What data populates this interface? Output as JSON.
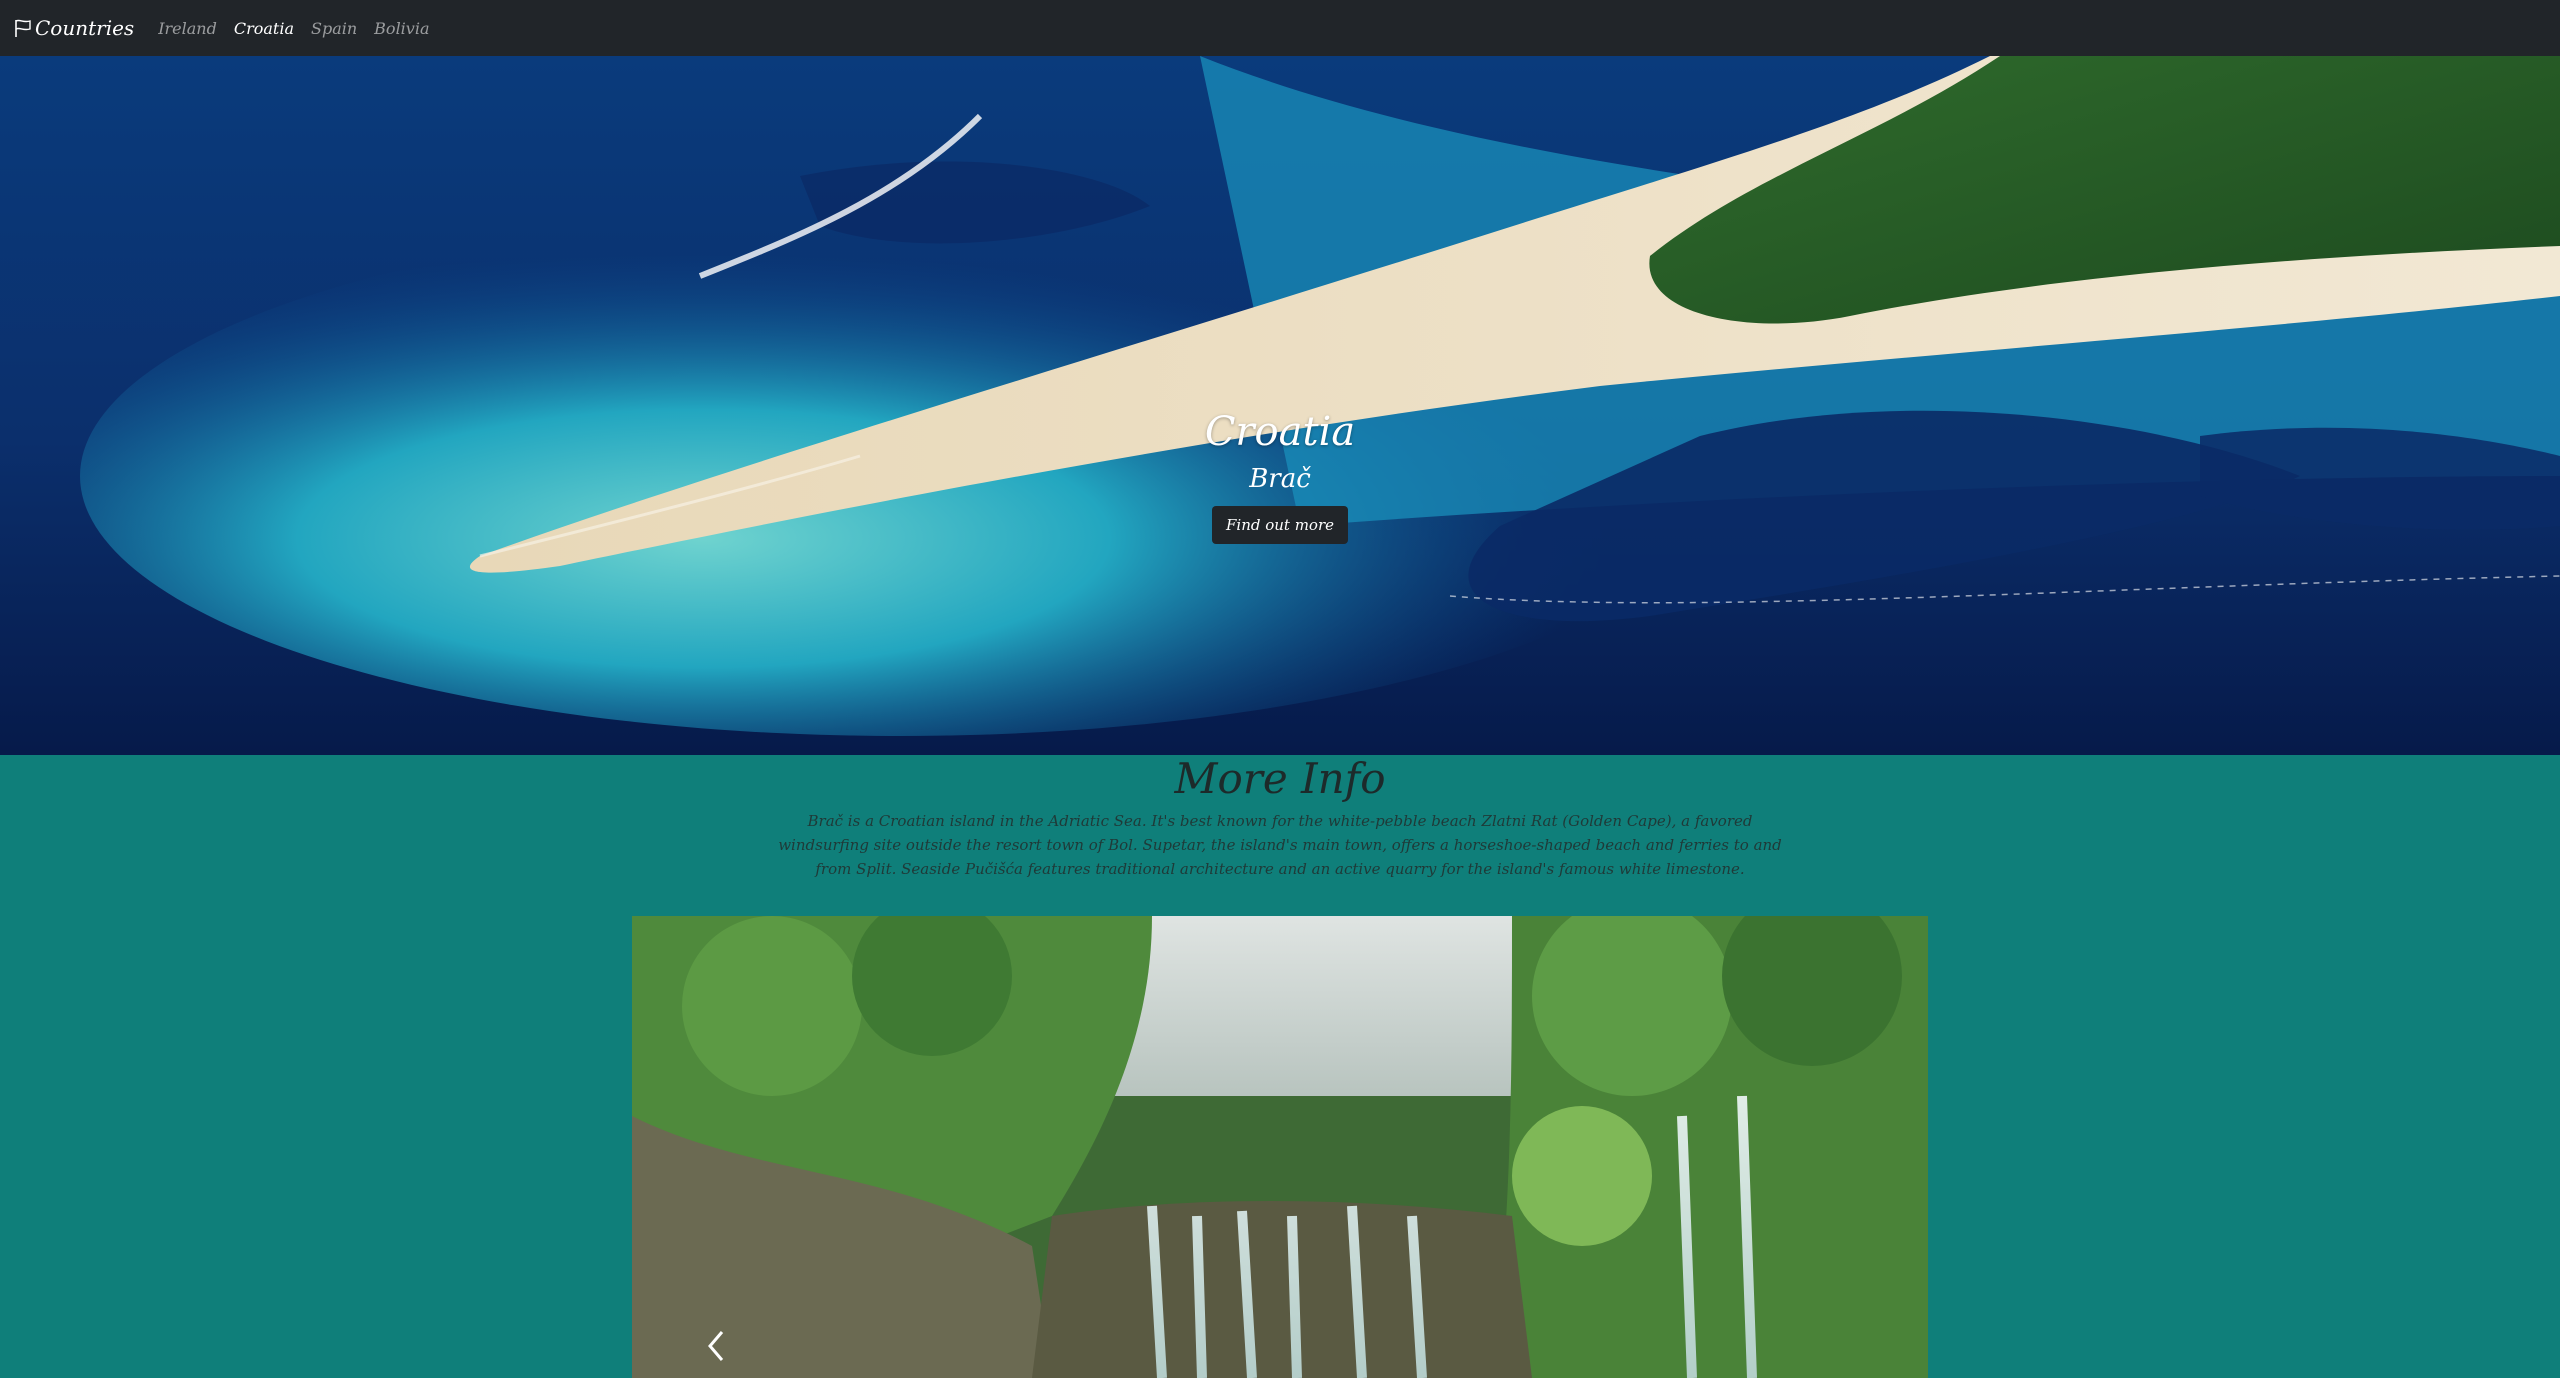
{
  "navbar": {
    "brand": "Countries",
    "brand_icon": "flag-icon",
    "links": [
      {
        "label": "Ireland",
        "active": false
      },
      {
        "label": "Croatia",
        "active": true
      },
      {
        "label": "Spain",
        "active": false
      },
      {
        "label": "Bolivia",
        "active": false
      }
    ]
  },
  "hero": {
    "title": "Croatia",
    "subtitle": "Brač",
    "button_label": "Find out more"
  },
  "info": {
    "heading": "More Info",
    "text": "Brač is a Croatian island in the Adriatic Sea. It's best known for the white-pebble beach Zlatni Rat (Golden Cape), a favored windsurfing site outside the resort town of Bol. Supetar, the island's main town, offers a horseshoe-shaped beach and ferries to and from Split. Seaside Pučišća features traditional architecture and an active quarry for the island's famous white limestone."
  },
  "carousel": {
    "prev_icon": "chevron-left-icon"
  },
  "colors": {
    "navbar_bg": "#212529",
    "page_bg": "#0f7f7a",
    "button_bg": "#212529"
  }
}
